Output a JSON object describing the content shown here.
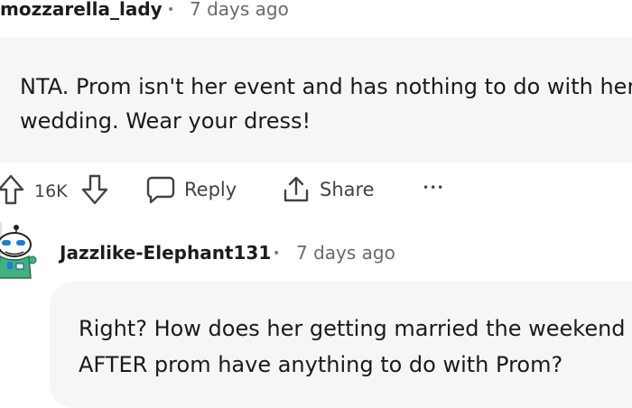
{
  "comment": {
    "username": "mozzarella_lady",
    "separator": "•",
    "time": "7 days ago",
    "text_line1": "NTA. Prom isn't her event and has nothing to do with her",
    "text_line2": "wedding. Wear your dress!",
    "vote_count": "16K",
    "reply_label": "Reply",
    "share_label": "Share",
    "more_label": "•••"
  },
  "reply": {
    "username": "Jazzlike-Elephant131",
    "separator": "•",
    "time": "7 days ago",
    "text_line1": "Right? How does her getting married the weekend",
    "text_line2": "AFTER prom have anything to do with Prom?"
  },
  "icons": {
    "upvote": "upvote-arrow-icon",
    "downvote": "downvote-arrow-icon",
    "reply": "speech-bubble-icon",
    "share": "share-upload-icon",
    "more": "more-dots-icon",
    "avatar": "snoo-avatar"
  }
}
